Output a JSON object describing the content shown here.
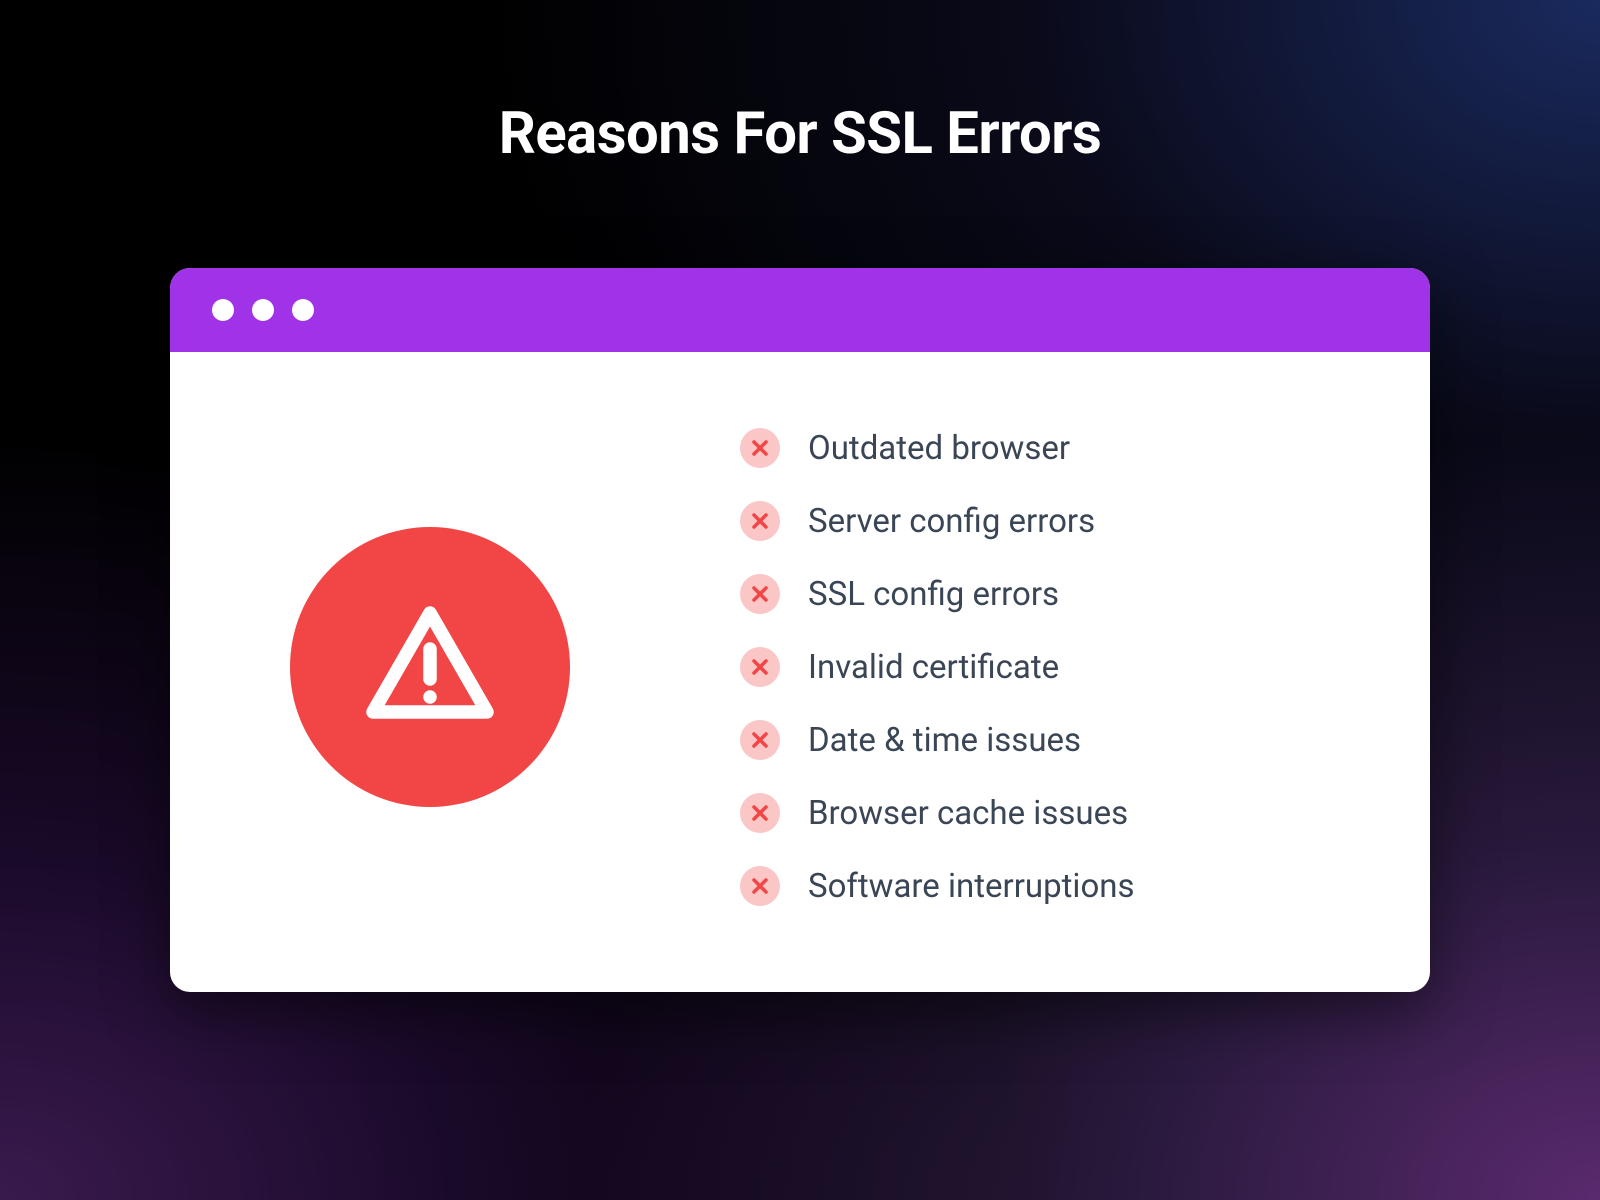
{
  "title": "Reasons For SSL Errors",
  "reasons": [
    "Outdated browser",
    "Server config errors",
    "SSL config errors",
    "Invalid certificate",
    "Date & time issues",
    "Browser cache issues",
    "Software interruptions"
  ],
  "colors": {
    "titlebar": "#a032e8",
    "warning": "#f24646",
    "badge": "#fac6c6",
    "text": "#3a4555"
  }
}
